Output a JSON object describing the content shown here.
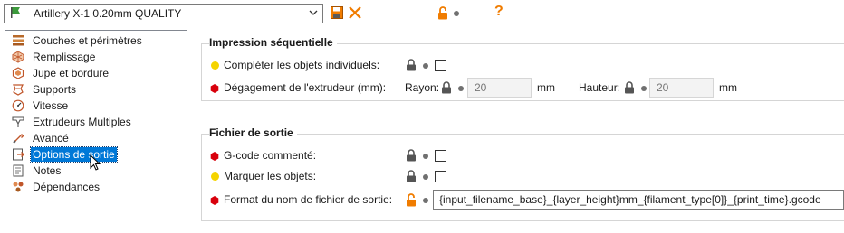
{
  "toolbar": {
    "preset_name": "Artillery X-1 0.20mm QUALITY",
    "preset_icon": "green-flag-icon",
    "save_icon": "save-icon",
    "delete_icon": "delete-x-icon",
    "lock_icon": "open-lock-icon",
    "help_label": "?"
  },
  "sidebar": {
    "items": [
      {
        "label": "Couches et périmètres",
        "icon": "layers-icon"
      },
      {
        "label": "Remplissage",
        "icon": "infill-icon"
      },
      {
        "label": "Jupe et bordure",
        "icon": "skirt-brim-icon"
      },
      {
        "label": "Supports",
        "icon": "supports-icon"
      },
      {
        "label": "Vitesse",
        "icon": "speed-icon"
      },
      {
        "label": "Extrudeurs Multiples",
        "icon": "multiple-extruders-icon"
      },
      {
        "label": "Avancé",
        "icon": "advanced-icon"
      },
      {
        "label": "Options de sortie",
        "icon": "output-options-icon",
        "selected": true
      },
      {
        "label": "Notes",
        "icon": "notes-icon"
      },
      {
        "label": "Dépendances",
        "icon": "dependencies-icon"
      }
    ]
  },
  "sequential": {
    "title": "Impression séquentielle",
    "complete_objects_label": "Compléter les objets individuels:",
    "extruder_clearance_label": "Dégagement de l'extrudeur (mm):",
    "radius_label": "Rayon:",
    "radius_value": "20",
    "radius_unit": "mm",
    "height_label": "Hauteur:",
    "height_value": "20",
    "height_unit": "mm"
  },
  "output": {
    "title": "Fichier de sortie",
    "gcode_comments_label": "G-code commenté:",
    "label_objects_label": "Marquer les objets:",
    "filename_format_label": "Format du nom de fichier de sortie:",
    "filename_format_value": "{input_filename_base}_{layer_height}mm_{filament_type[0]}_{print_time}.gcode"
  },
  "colors": {
    "mode_simple": "#f5d400",
    "mode_expert": "#d8000c",
    "accent_orange": "#f07c00",
    "selection": "#0078d7"
  }
}
